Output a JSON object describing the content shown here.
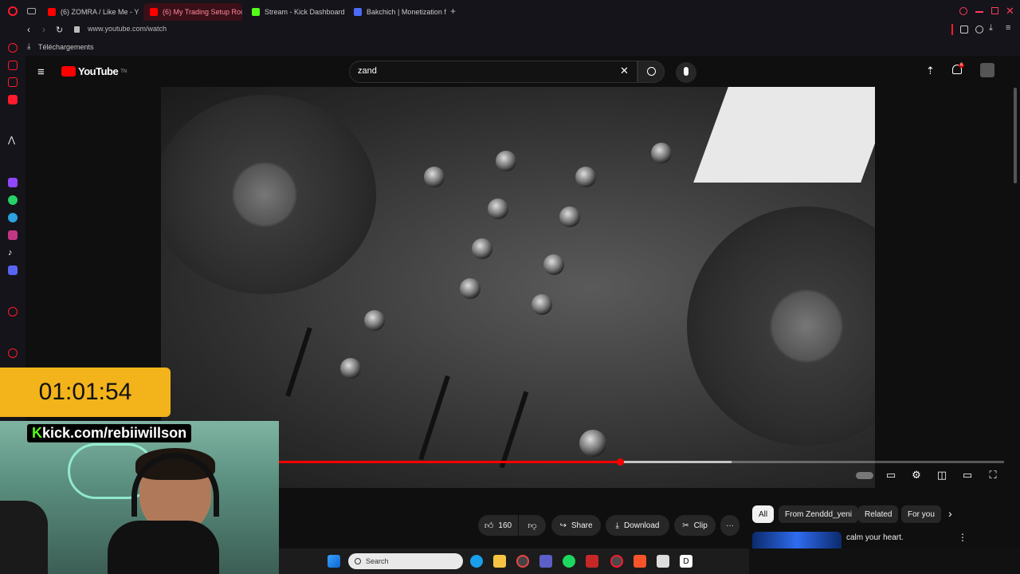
{
  "browser": {
    "tabs": [
      {
        "label": "(6) ZOMRA / Like Me - Yo",
        "color": "#ff0000",
        "active": false
      },
      {
        "label": "(6) My Trading Setup Roo",
        "color": "#ff0000",
        "active": true
      },
      {
        "label": "Stream - Kick Dashboard",
        "color": "#53fc18",
        "active": false
      },
      {
        "label": "Bakchich | Monetization f",
        "color": "#4a6cf7",
        "active": false
      }
    ],
    "new_tab": "+",
    "url": "www.youtube.com/watch",
    "downloads_label": "Téléchargements"
  },
  "youtube": {
    "logo_text": "YouTube",
    "logo_suffix": "TN",
    "search_value": "zand",
    "notification_count": "6",
    "like_count": "160",
    "share_label": "Share",
    "download_label": "Download",
    "clip_label": "Clip",
    "more_label": "···",
    "progress_fraction": 0.47,
    "chips": [
      "All",
      "From Zenddd_yeni",
      "Related",
      "For you"
    ],
    "chip_next": "›",
    "recommendation_title": "calm your heart."
  },
  "overlay": {
    "timer": "01:01:54",
    "kick_prefix": "K",
    "kick_url": "kick.com/rebiiwillson"
  },
  "taskbar": {
    "search_placeholder": "Search"
  },
  "colors": {
    "accent": "#ff0000",
    "timer_bg": "#f3b31a",
    "kick_green": "#53fc18"
  }
}
